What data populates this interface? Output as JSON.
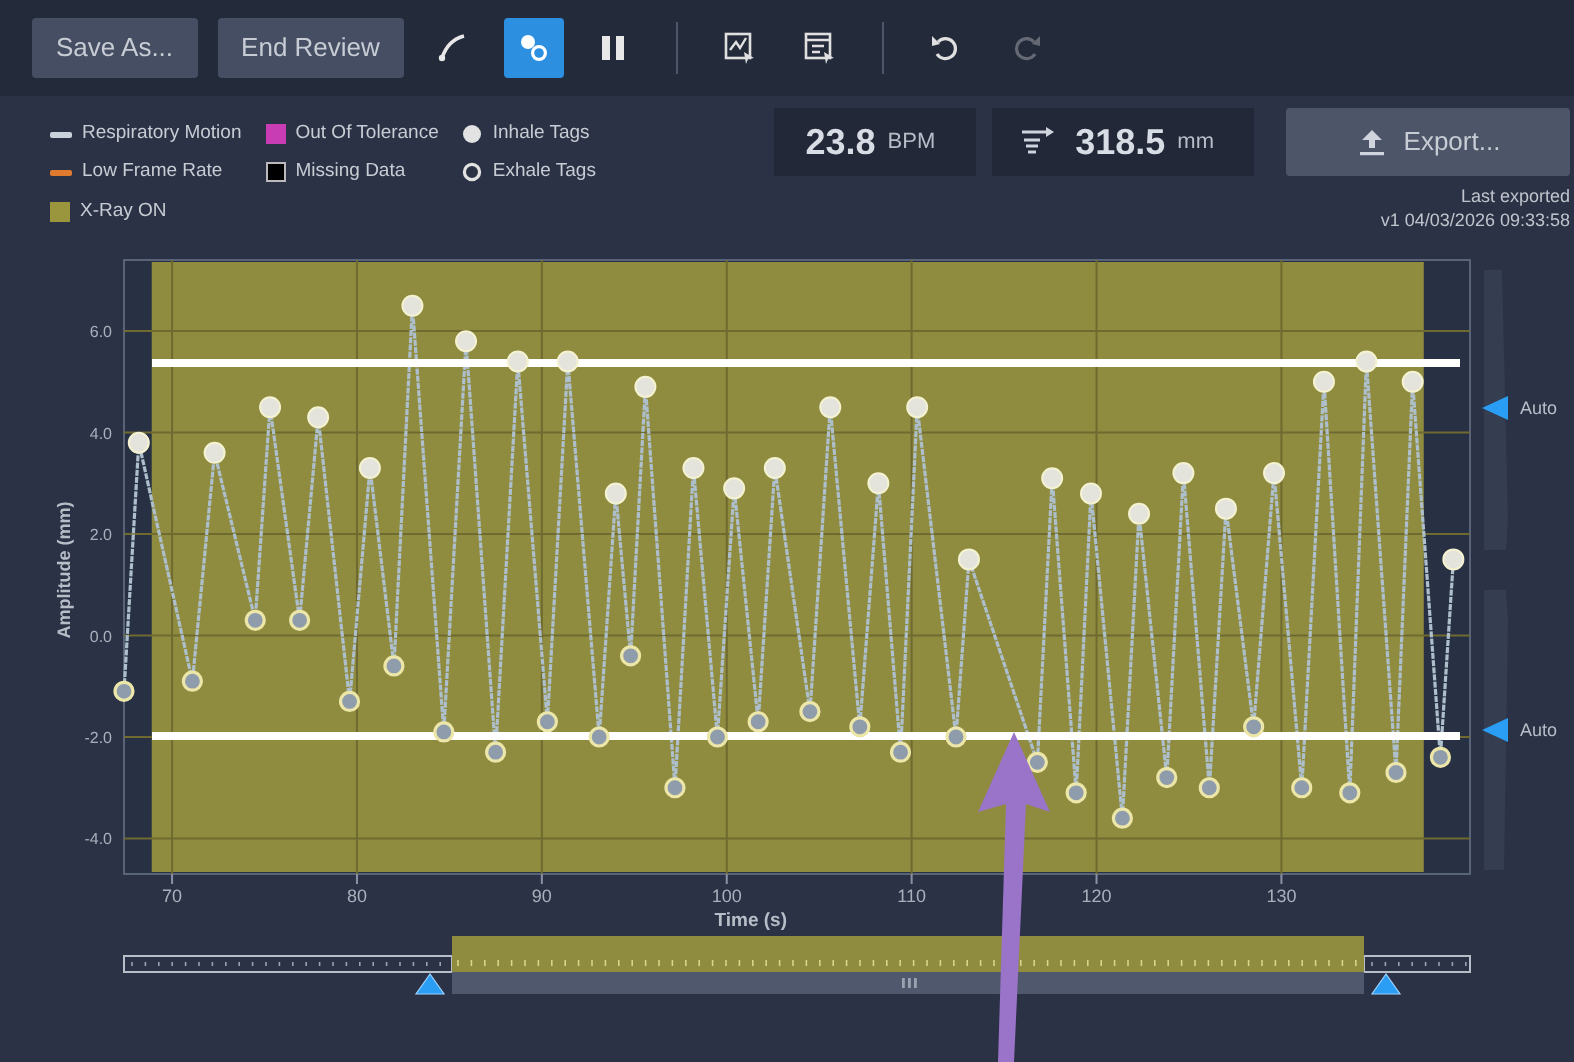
{
  "toolbar": {
    "buttons": [
      {
        "label": "Save As..."
      },
      {
        "label": "End Review"
      }
    ],
    "tool_groups": [
      [
        {
          "kind": "curve",
          "selected": false,
          "disabled": false
        },
        {
          "kind": "tags",
          "selected": true,
          "disabled": false
        },
        {
          "kind": "pause",
          "selected": false,
          "disabled": false
        }
      ],
      [
        {
          "kind": "chart-zoom",
          "selected": false,
          "disabled": false
        },
        {
          "kind": "chart-export",
          "selected": false,
          "disabled": false
        }
      ],
      [
        {
          "kind": "undo",
          "selected": false,
          "disabled": false
        },
        {
          "kind": "redo",
          "selected": false,
          "disabled": true
        }
      ]
    ]
  },
  "legend": [
    {
      "label": "Respiratory Motion",
      "kind": "line",
      "color": "#c9d3dc"
    },
    {
      "label": "Out Of Tolerance",
      "kind": "square",
      "color": "#c83cb4"
    },
    {
      "label": "Inhale Tags",
      "kind": "dot",
      "color": "#e2e2e2"
    },
    {
      "label": "Low Frame Rate",
      "kind": "line",
      "color": "#e07a2e"
    },
    {
      "label": "Missing Data",
      "kind": "square",
      "color": "#000000"
    },
    {
      "label": "Exhale Tags",
      "kind": "ring",
      "color": "#e2e2e2"
    },
    {
      "label": "X-Ray ON",
      "kind": "square",
      "color": "#9a963e"
    }
  ],
  "stats": [
    {
      "kind": "rate",
      "value": "23.8",
      "unit": "BPM"
    },
    {
      "kind": "distance",
      "value": "318.5",
      "unit": "mm"
    }
  ],
  "export": {
    "label": "Export...",
    "note": "Last exported",
    "version": "v1 04/03/2026 09:33:58"
  },
  "chart_data": {
    "type": "line",
    "xlabel": "Time (s)",
    "ylabel": "Amplitude (mm)",
    "x": [
      67.4,
      68.2,
      71.1,
      72.3,
      74.5,
      75.3,
      76.9,
      77.9,
      79.6,
      80.7,
      82.0,
      83.0,
      84.7,
      85.9,
      87.5,
      88.7,
      90.3,
      91.4,
      93.1,
      94.0,
      94.8,
      95.6,
      97.2,
      98.2,
      99.5,
      100.4,
      101.7,
      102.6,
      104.5,
      105.6,
      107.2,
      108.2,
      109.4,
      110.3,
      112.4,
      113.1,
      116.8,
      117.6,
      118.9,
      119.7,
      121.4,
      122.3,
      123.8,
      124.7,
      126.1,
      127.0,
      128.5,
      129.6,
      131.1,
      132.3,
      133.7,
      134.6,
      136.2,
      137.1,
      138.6,
      139.3
    ],
    "grid": true,
    "series": [
      {
        "color": "#aebfcc",
        "line_style": "dashed",
        "marker": "circle",
        "values": [
          -1.1,
          3.8,
          -0.9,
          3.6,
          0.3,
          4.5,
          0.3,
          4.3,
          -1.3,
          3.3,
          -0.6,
          6.5,
          -1.9,
          5.8,
          -2.3,
          5.4,
          -1.7,
          5.4,
          -2.0,
          2.8,
          -0.4,
          4.9,
          -3.0,
          3.3,
          -2.0,
          2.9,
          -1.7,
          3.3,
          -1.5,
          4.5,
          -1.8,
          3.0,
          -2.3,
          4.5,
          -2.0,
          1.5,
          -2.5,
          3.1,
          -3.1,
          2.8,
          -3.6,
          2.4,
          -2.8,
          3.2,
          -3.0,
          2.5,
          -1.8,
          3.2,
          -3.0,
          5.0,
          -3.1,
          5.4,
          -2.7,
          5.0,
          -2.4,
          1.5
        ]
      }
    ],
    "xlim": [
      67.4,
      140.2
    ],
    "ylim": [
      -4.7,
      7.4
    ],
    "xticks": [
      70,
      80,
      90,
      100,
      110,
      120,
      130
    ],
    "yticks": [
      {
        "value": -4,
        "label": "-4.0"
      },
      {
        "value": -2,
        "label": "-2.0"
      },
      {
        "value": 0,
        "label": "0.0"
      },
      {
        "value": 2,
        "label": "2.0"
      },
      {
        "value": 4,
        "label": "4.0"
      },
      {
        "value": 6,
        "label": "6.0"
      }
    ],
    "bands": [
      {
        "axis": "x",
        "from": 68.9,
        "to": 137.7
      }
    ],
    "ref_lines": [
      {
        "axis": "y",
        "value": 5.37
      },
      {
        "axis": "y",
        "value": -1.98
      }
    ]
  },
  "auto_markers": [
    {
      "label": "Auto"
    },
    {
      "label": "Auto"
    }
  ]
}
